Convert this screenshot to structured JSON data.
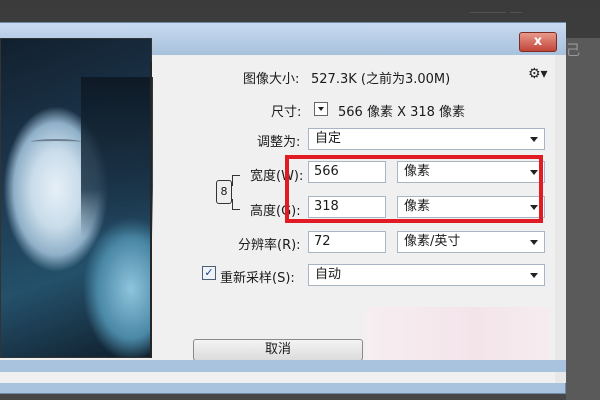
{
  "background": {
    "text": "＿＿＿ ＿",
    "right_label": "己"
  },
  "dialog": {
    "close_label": "x",
    "image_size_label": "图像大小:",
    "image_size_value": "527.3K (之前为3.00M)",
    "dimensions_label": "尺寸:",
    "dimensions_value": "566 像素  X  318 像素",
    "fit_to_label": "调整为:",
    "fit_to_value": "自定",
    "width_label": "宽度(W):",
    "width_value": "566",
    "width_unit": "像素",
    "height_label": "高度(G):",
    "height_value": "318",
    "height_unit": "像素",
    "resolution_label": "分辨率(R):",
    "resolution_value": "72",
    "resolution_unit": "像素/英寸",
    "resample_label": "重新采样(S):",
    "resample_checked": true,
    "resample_value": "自动",
    "cancel_label": "取消",
    "checkbox_mark": "✓"
  },
  "colors": {
    "highlight": "#e01b23",
    "dialog_frame": "#a9c3df"
  },
  "icons": {
    "gear": "gear-icon",
    "chain": "chain-link-icon",
    "close": "close-icon"
  }
}
